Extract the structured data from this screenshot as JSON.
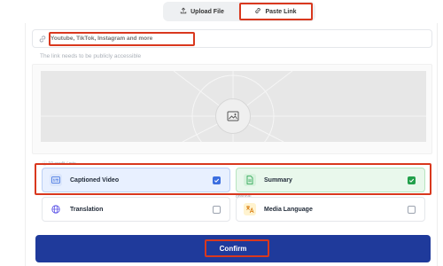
{
  "tabs": [
    {
      "label": "Upload File",
      "icon": "upload-icon",
      "active": false
    },
    {
      "label": "Paste Link",
      "icon": "link-icon",
      "active": true
    }
  ],
  "link_input": {
    "icon": "link-icon",
    "placeholder": "Youtube, TikTok, Instagram and more",
    "value": ""
  },
  "hint": "The link needs to be publicly accessible",
  "preview": {
    "icon": "image-placeholder-icon"
  },
  "options_caption": "ⓘ 10 credit / min",
  "optional_caption": "optional",
  "options": [
    {
      "label": "Captioned Video",
      "icon": "subtitles-icon",
      "checked": true
    },
    {
      "label": "Summary",
      "icon": "document-icon",
      "checked": true
    },
    {
      "label": "Translation",
      "icon": "globe-icon",
      "checked": false
    },
    {
      "label": "Media Language",
      "icon": "language-icon",
      "checked": false
    }
  ],
  "confirm_label": "Confirm",
  "colors": {
    "accent_blue": "#1f3a9b",
    "check_blue": "#3b6ee0",
    "check_green": "#22a04b",
    "annotation_red": "#d9381e"
  }
}
